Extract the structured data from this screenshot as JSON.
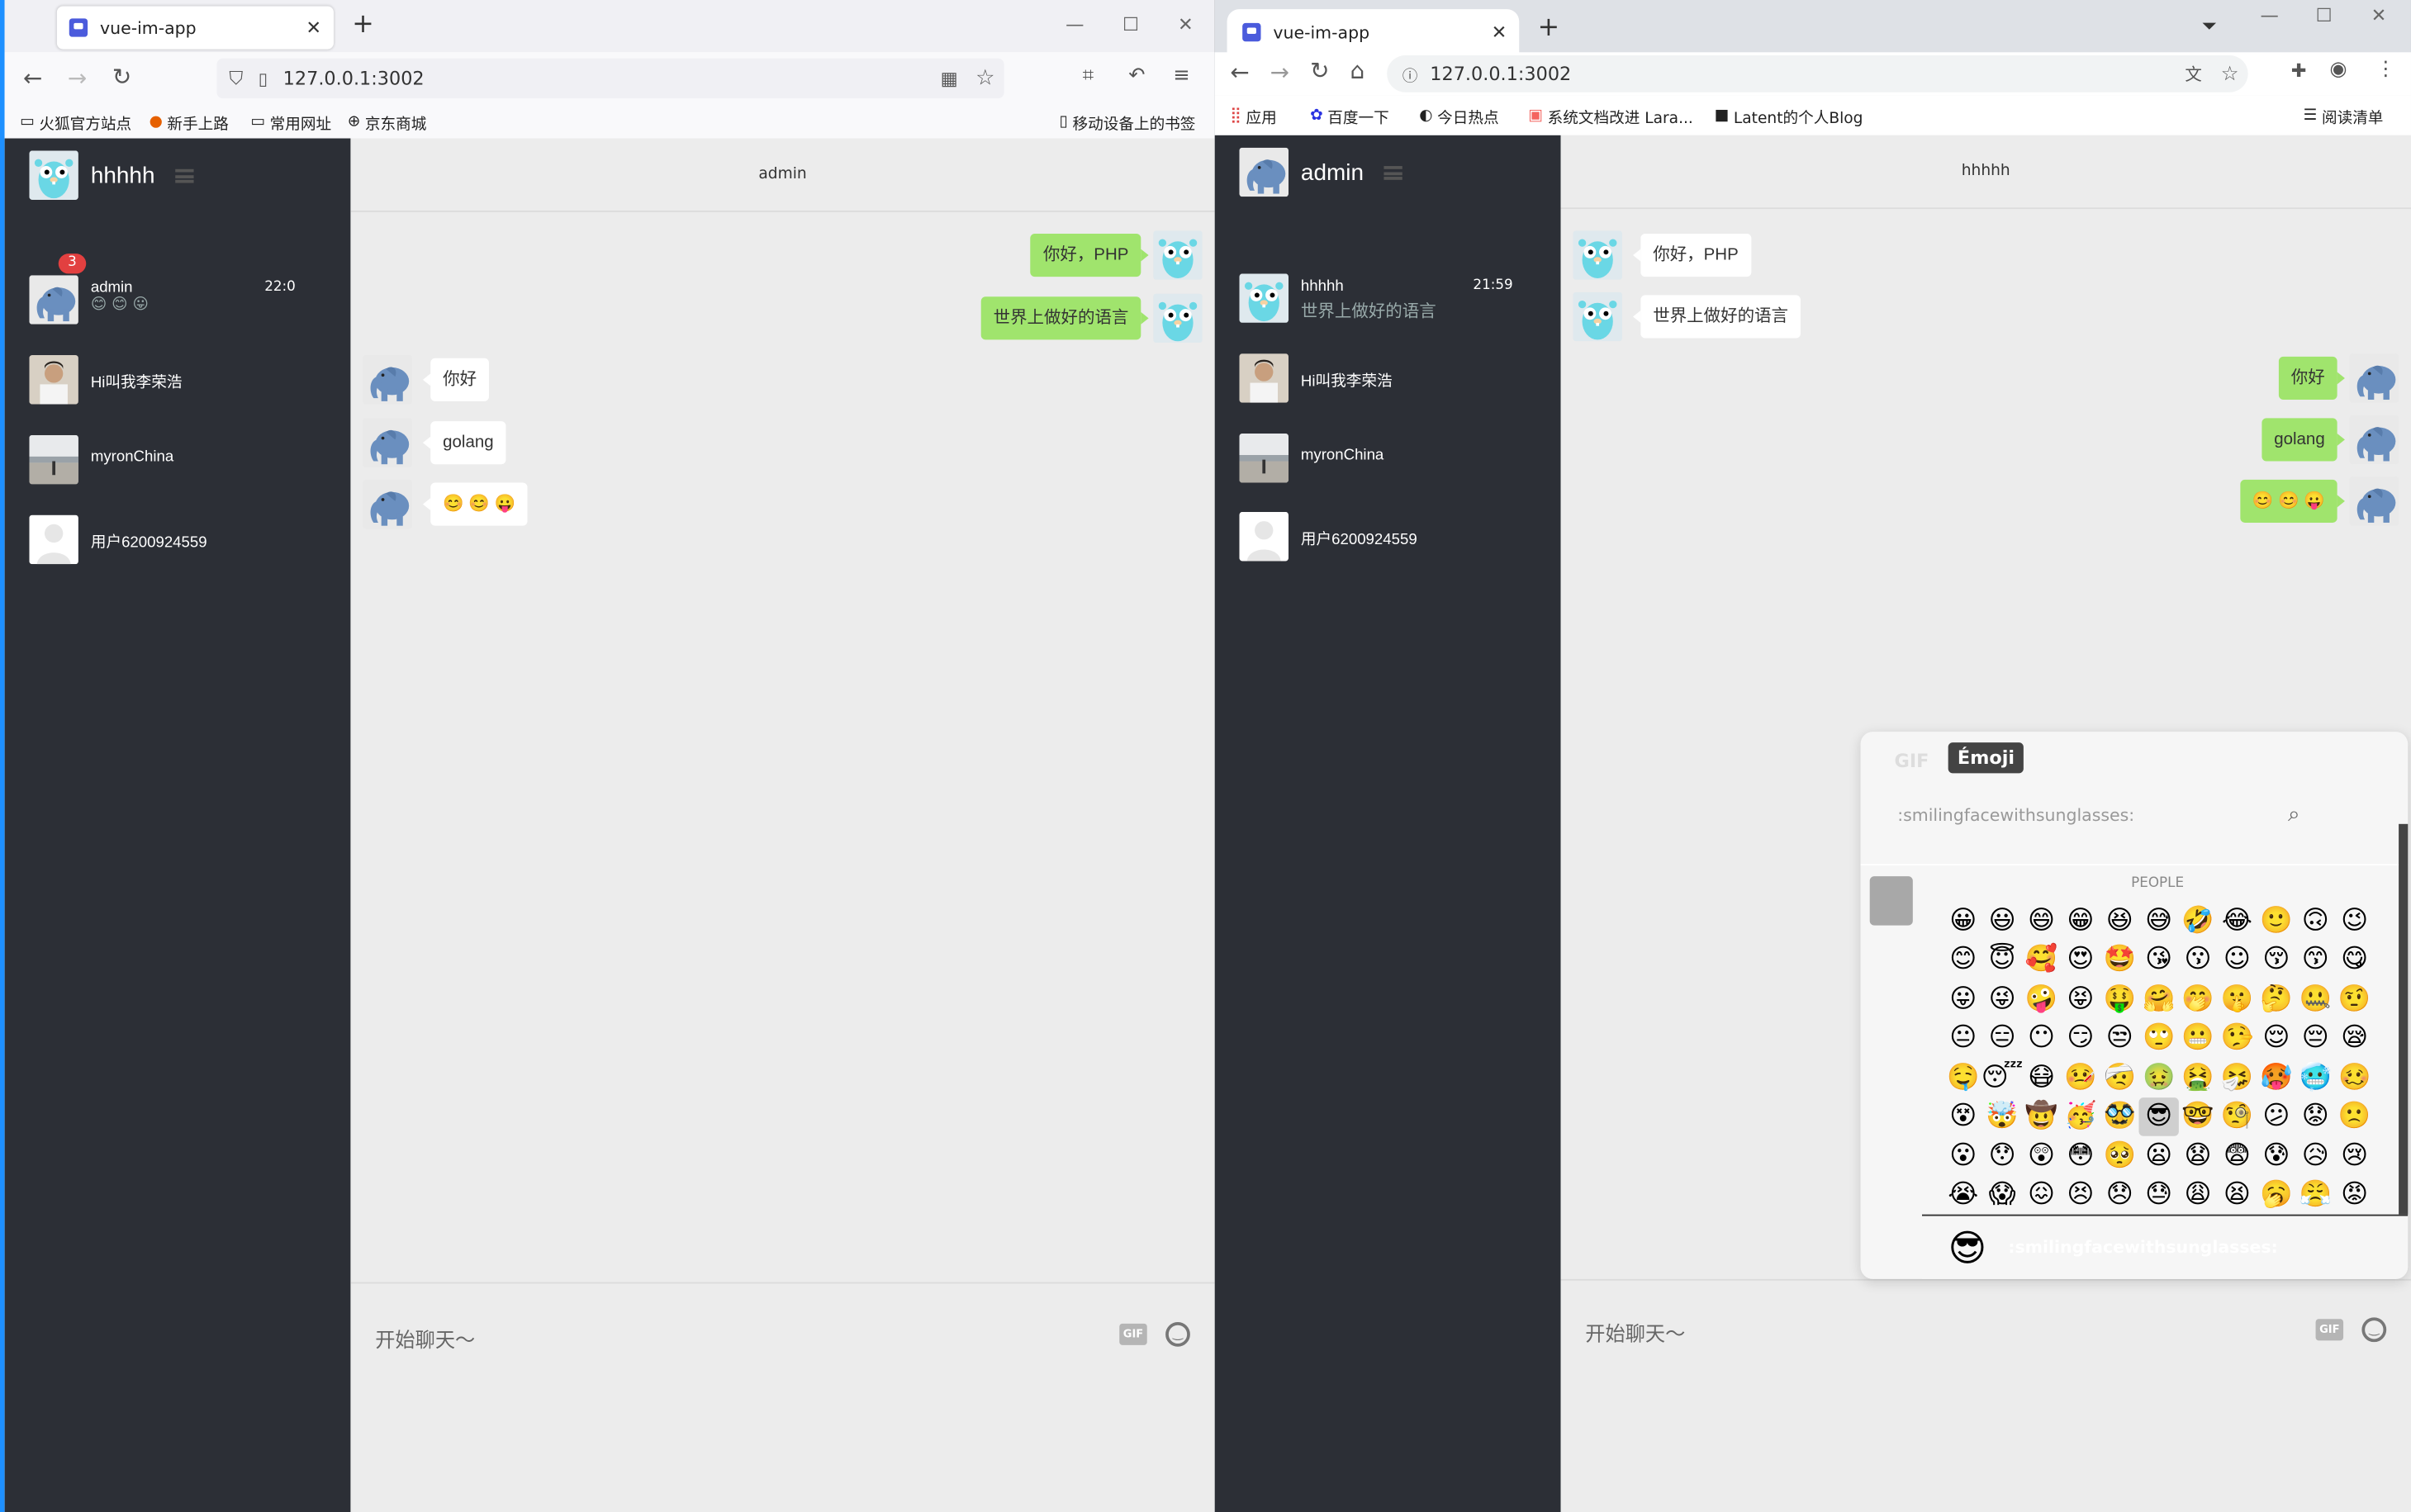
{
  "left_window": {
    "tab": {
      "title": "vue-im-app",
      "close": "✕",
      "new": "+"
    },
    "controls": [
      "—",
      "☐",
      "✕"
    ],
    "url": "127.0.0.1:3002",
    "bookmarks": [
      "火狐官方站点",
      "新手上路",
      "常用网址",
      "京东商城"
    ],
    "bookmarks_right": "移动设备上的书签",
    "sidebar": {
      "user_name": "hhhhh",
      "contacts": [
        {
          "name": "admin",
          "sub": "😊 😊 😛",
          "time": "22:0",
          "badge": "3",
          "avatar": "elephant"
        },
        {
          "name": "Hi叫我李荣浩",
          "avatar": "photo"
        },
        {
          "name": "myronChina",
          "avatar": "beach"
        },
        {
          "name": "用户6200924559",
          "avatar": "blank"
        }
      ]
    },
    "chat": {
      "title": "admin",
      "messages": [
        {
          "side": "right",
          "text": "你好，PHP",
          "avatar": "gopher"
        },
        {
          "side": "right",
          "text": "世界上做好的语言",
          "avatar": "gopher"
        },
        {
          "side": "left",
          "text": "你好",
          "avatar": "elephant"
        },
        {
          "side": "left",
          "text": "golang",
          "avatar": "elephant"
        },
        {
          "side": "left",
          "text": "😊 😊 😛",
          "avatar": "elephant"
        }
      ],
      "placeholder": "开始聊天～",
      "gif_label": "GIF"
    }
  },
  "right_window": {
    "tab": {
      "title": "vue-im-app",
      "close": "✕",
      "new": "+"
    },
    "controls": [
      "—",
      "☐",
      "✕"
    ],
    "url": "127.0.0.1:3002",
    "bookmarks": [
      "应用",
      "百度一下",
      "今日热点",
      "系统文档改进 Lara...",
      "Latent的个人Blog"
    ],
    "bookmarks_right": "阅读清单",
    "sidebar": {
      "user_name": "admin",
      "contacts": [
        {
          "name": "hhhhh",
          "sub": "世界上做好的语言",
          "time": "21:59",
          "avatar": "gopher"
        },
        {
          "name": "Hi叫我李荣浩",
          "avatar": "photo"
        },
        {
          "name": "myronChina",
          "avatar": "beach"
        },
        {
          "name": "用户6200924559",
          "avatar": "blank"
        }
      ]
    },
    "chat": {
      "title": "hhhhh",
      "messages": [
        {
          "side": "left",
          "text": "你好，PHP",
          "avatar": "gopher"
        },
        {
          "side": "left",
          "text": "世界上做好的语言",
          "avatar": "gopher"
        },
        {
          "side": "right",
          "text": "你好",
          "avatar": "elephant"
        },
        {
          "side": "right",
          "text": "golang",
          "avatar": "elephant"
        },
        {
          "side": "right",
          "text": "😊 😊 😛",
          "avatar": "elephant"
        }
      ],
      "placeholder": "开始聊天～",
      "gif_label": "GIF"
    },
    "emoji_picker": {
      "tabs": [
        "GIF",
        "Émoji"
      ],
      "active_tab": "Émoji",
      "search_value": ":smilingfacewithsunglasses:",
      "category": "PEOPLE",
      "preview_name": ":smilingfacewithsunglasses:",
      "preview_emoji": "😎",
      "rows": [
        "😀😃😄😁😆😅🤣😂🙂🙃😉",
        "😊😇🥰😍🤩😘😗☺😚😙😋",
        "😛😜🤪😝🤑🤗🤭🤫🤔🤐🤨",
        "😐😑😶😏😒🙄😬🤥😌😔😪",
        "🤤😴😷🤒🤕🤢🤮🤧🥵🥶🥴",
        "😵🤯🤠🥳🥸😎🤓🧐😕😟🙁",
        "😮😯😲😳🥺😦😧😨😰😥😢",
        "😭😱😖😣😞😓😩😫🥱😤😡"
      ]
    }
  },
  "colors": {
    "sidebar": "#2c2f36",
    "chat_bg": "#ececec",
    "bubble_green": "#a0e46d",
    "accent": "#1e90ff"
  }
}
